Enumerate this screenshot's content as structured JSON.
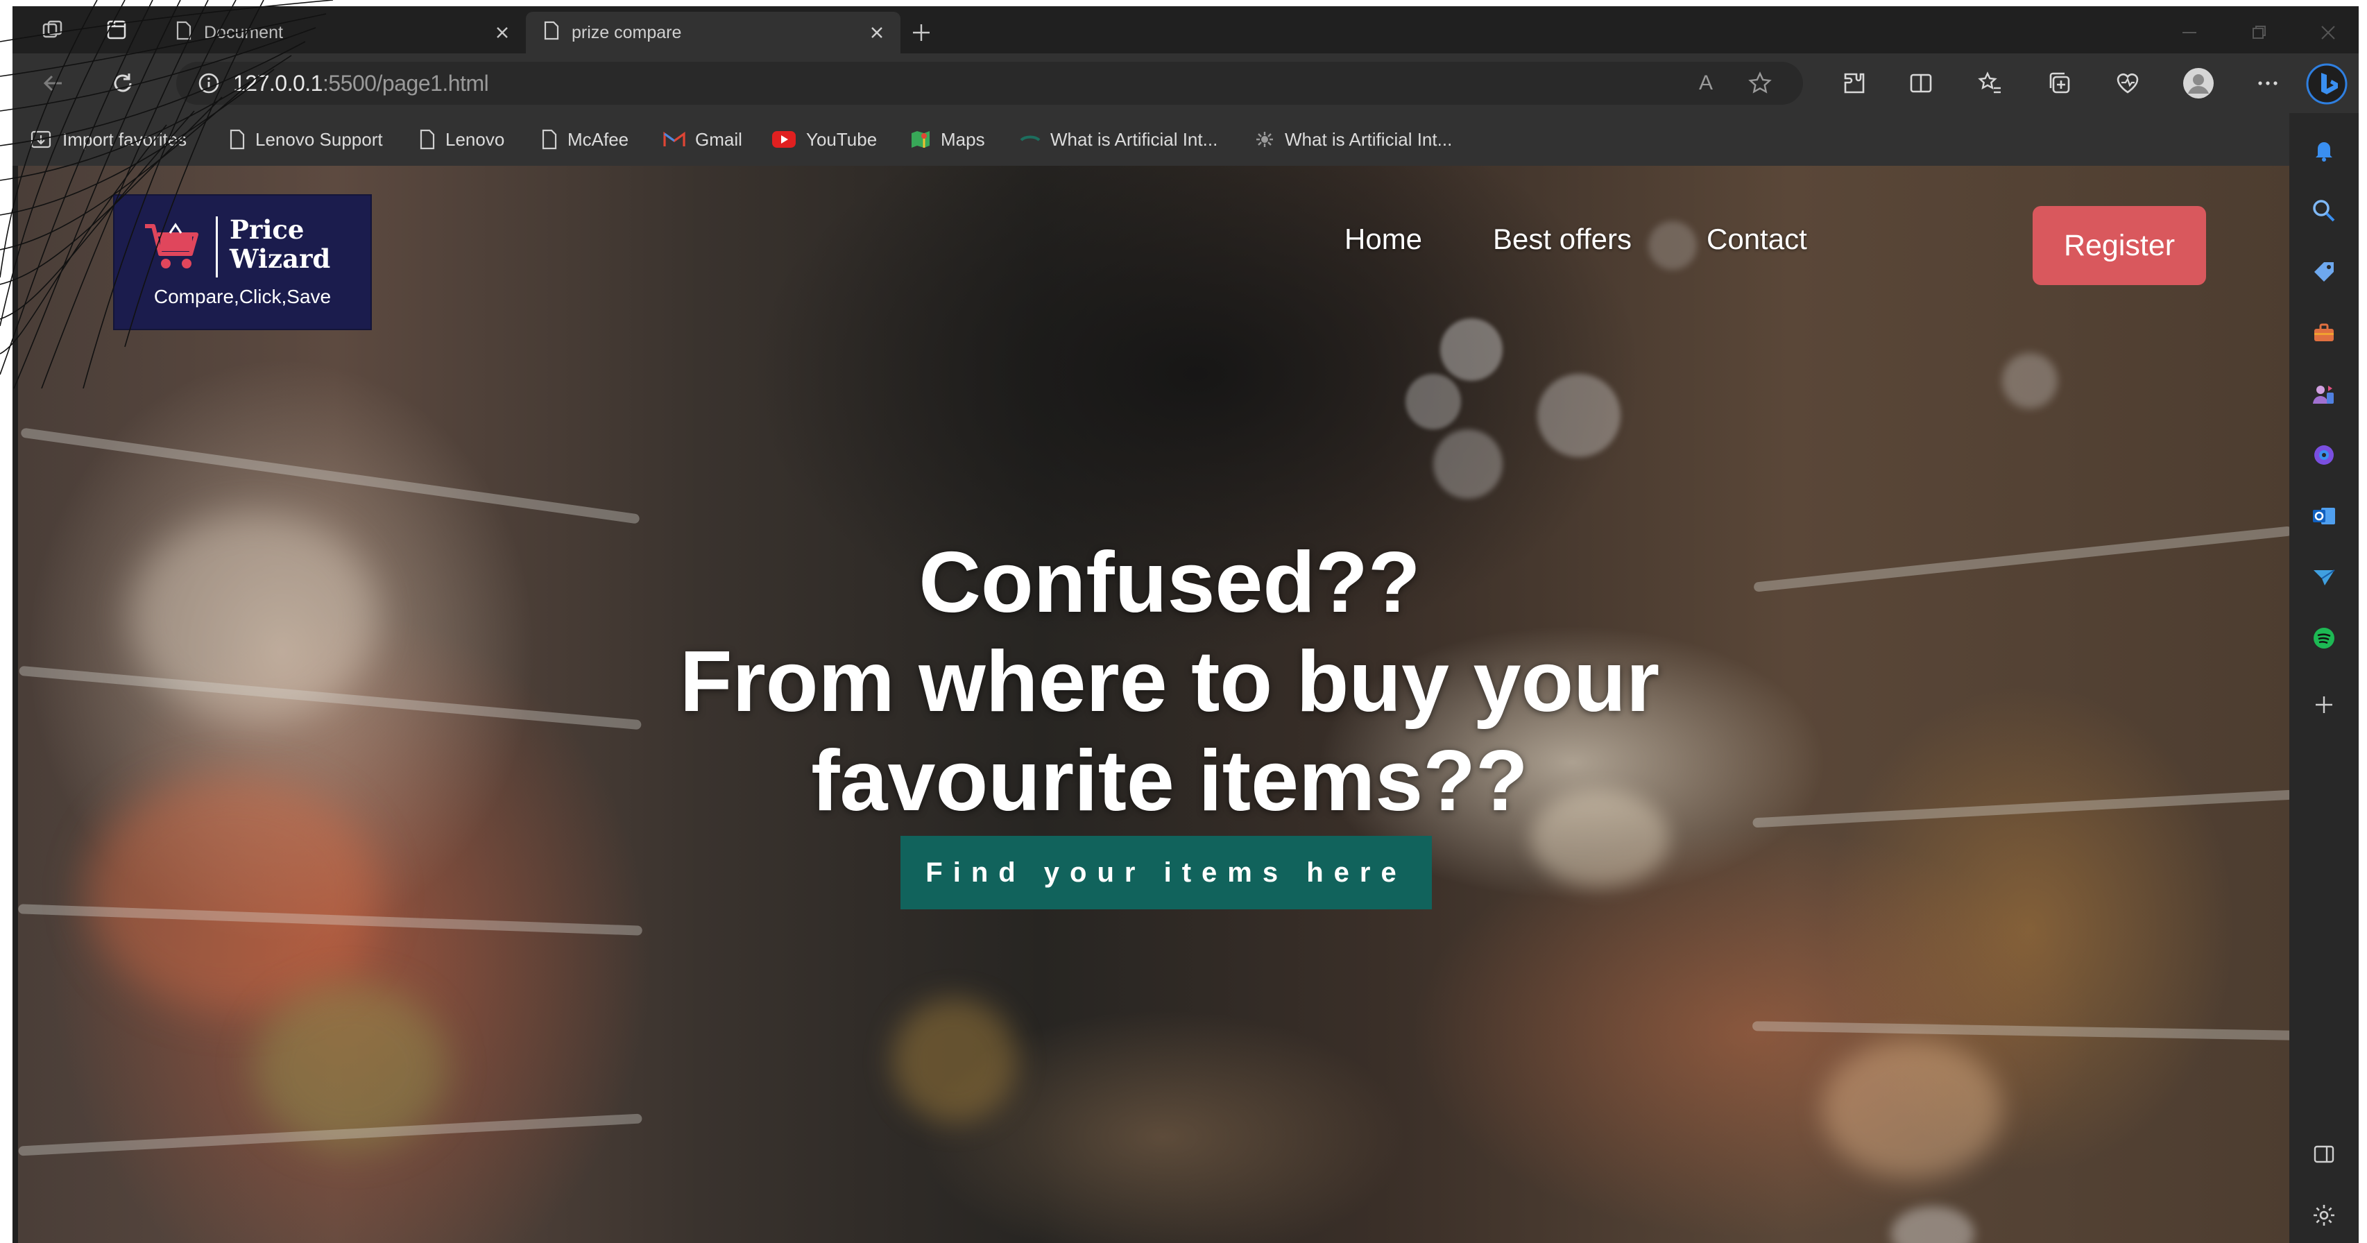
{
  "browser": {
    "tabs": [
      {
        "title": "Document",
        "active": false
      },
      {
        "title": "prize compare",
        "active": true
      }
    ],
    "address": {
      "host": "127.0.0.1",
      "rest": ":5500/page1.html",
      "read_aloud_label": "A"
    },
    "bookmarks": [
      {
        "label": "Import favorites",
        "icon": "import-icon"
      },
      {
        "label": "Lenovo Support",
        "icon": "page-icon"
      },
      {
        "label": "Lenovo",
        "icon": "page-icon"
      },
      {
        "label": "McAfee",
        "icon": "page-icon"
      },
      {
        "label": "Gmail",
        "icon": "gmail-icon"
      },
      {
        "label": "YouTube",
        "icon": "youtube-icon"
      },
      {
        "label": "Maps",
        "icon": "maps-icon"
      },
      {
        "label": "What is Artificial Int...",
        "icon": "site-icon"
      },
      {
        "label": "What is Artificial Int...",
        "icon": "site-icon"
      }
    ],
    "sidebar_icons": [
      "bell-icon",
      "search-icon",
      "tag-icon",
      "toolbox-icon",
      "people-icon",
      "copilot-icon",
      "outlook-icon",
      "send-icon",
      "spotify-icon",
      "plus-icon",
      "panel-icon",
      "gear-icon"
    ]
  },
  "site": {
    "logo": {
      "line1": "Price",
      "line2": "Wizard",
      "tagline": "Compare,Click,Save"
    },
    "nav": [
      {
        "label": "Home"
      },
      {
        "label": "Best offers"
      },
      {
        "label": "Contact"
      }
    ],
    "register_label": "Register",
    "headline": [
      "Confused??",
      "From where to buy your",
      "favourite items??"
    ],
    "cta_label": "Find your items here"
  },
  "colors": {
    "logo_bg": "#1b1c4d",
    "register_bg": "#d9585d",
    "cta_bg": "#11635c",
    "browser_chrome": "#323232"
  }
}
